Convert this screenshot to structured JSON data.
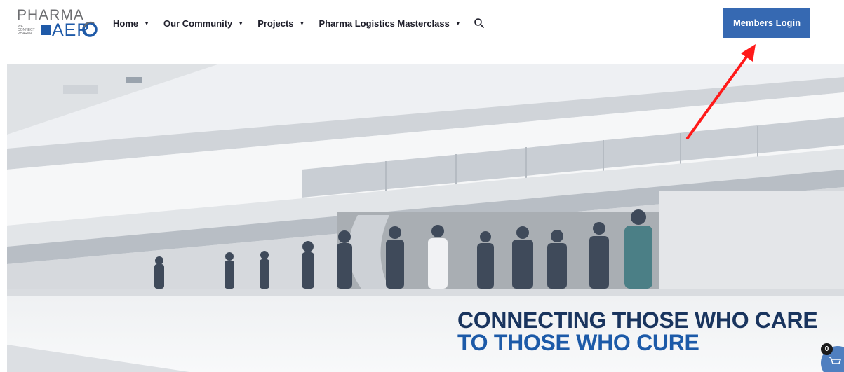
{
  "logo": {
    "word_top": "PHARMA",
    "tagline": "WE CONNECT PHARMA",
    "word_bottom": "AER"
  },
  "nav": {
    "items": [
      {
        "label": "Home",
        "has_dropdown": true
      },
      {
        "label": "Our Community",
        "has_dropdown": true
      },
      {
        "label": "Projects",
        "has_dropdown": true
      },
      {
        "label": "Pharma Logistics Masterclass",
        "has_dropdown": true
      }
    ],
    "caret": "▼",
    "search_icon": "search-icon"
  },
  "header": {
    "login_label": "Members Login"
  },
  "hero": {
    "heading_line1": "CONNECTING THOSE WHO CARE",
    "heading_line2": "TO THOSE WHO CURE"
  },
  "cart": {
    "count": "0",
    "icon": "cart-icon"
  },
  "colors": {
    "brand_blue": "#3669b2",
    "logo_blue": "#1f5aa8",
    "heading_dark": "#19345e",
    "heading_blue": "#1c5aa8",
    "annotation_arrow": "#ff1a1a"
  }
}
